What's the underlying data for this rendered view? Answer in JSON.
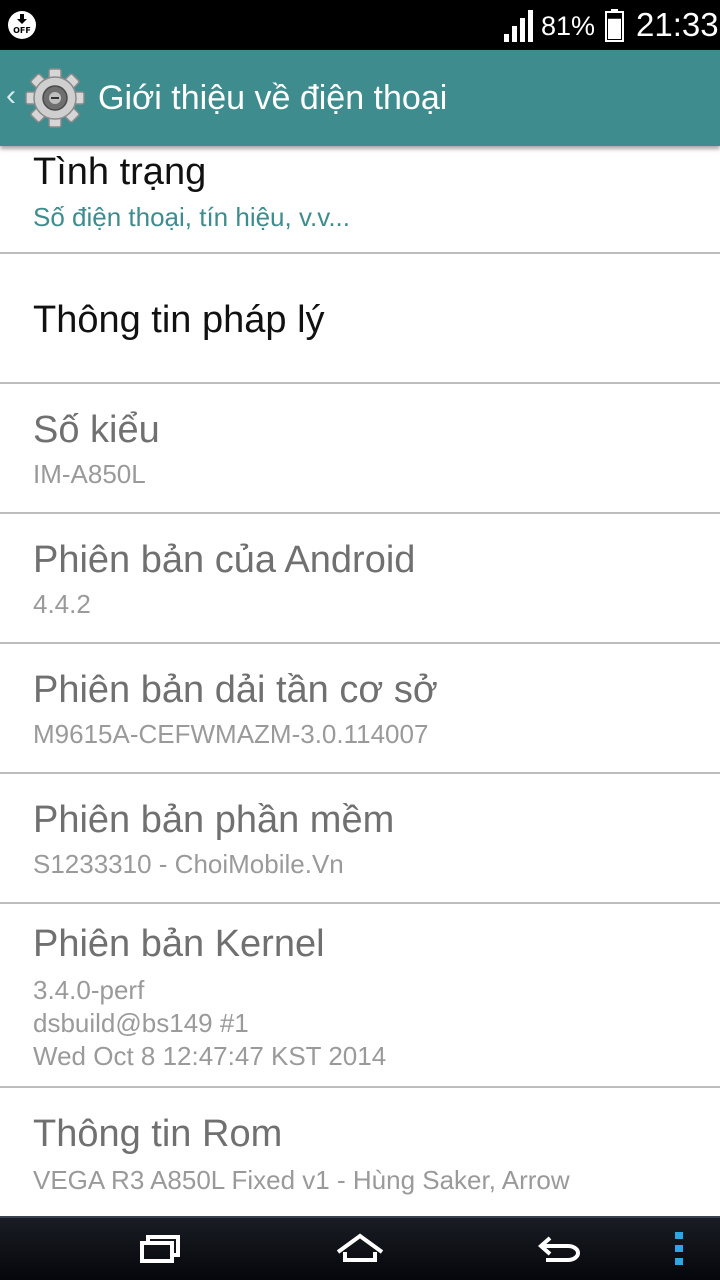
{
  "status_bar": {
    "left_icon": "download-off-icon",
    "left_icon_text": "OFF",
    "battery_percent": "81%",
    "battery_level": 0.81,
    "time": "21:33"
  },
  "action_bar": {
    "back_icon": "chevron-left-icon",
    "app_icon": "gear-icon",
    "title": "Giới thiệu về điện thoại"
  },
  "items": [
    {
      "title": "Tình trạng",
      "subtitle": "Số điện thoại, tín hiệu, v.v..."
    },
    {
      "title": "Thông tin pháp lý"
    },
    {
      "title": "Số kiểu",
      "subtitle": "IM-A850L"
    },
    {
      "title": "Phiên bản của Android",
      "subtitle": "4.4.2"
    },
    {
      "title": "Phiên bản dải tần cơ sở",
      "subtitle": "M9615A-CEFWMAZM-3.0.114007"
    },
    {
      "title": "Phiên bản phần mềm",
      "subtitle": "S1233310 - ChoiMobile.Vn"
    },
    {
      "title": "Phiên bản Kernel",
      "subtitle_lines": [
        "3.4.0-perf",
        "dsbuild@bs149 #1",
        "Wed Oct 8 12:47:47 KST 2014"
      ]
    },
    {
      "title": "Thông tin Rom",
      "subtitle": "VEGA R3 A850L Fixed v1 - Hùng Saker, Arrow"
    }
  ],
  "nav_bar": {
    "recent_icon": "recent-apps-icon",
    "home_icon": "home-icon",
    "back_icon": "back-arrow-icon",
    "menu_icon": "overflow-menu-icon"
  },
  "colors": {
    "action_bar": "#3f8c8f",
    "accent_text": "#3f8c8f",
    "status_bar": "#000000"
  }
}
